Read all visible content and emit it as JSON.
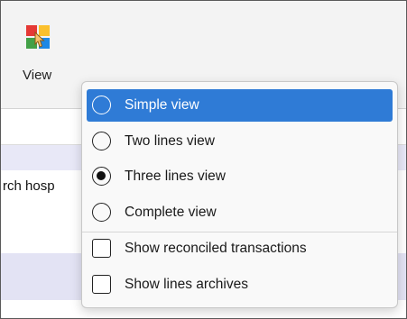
{
  "ribbon": {
    "view_button": {
      "label": "View",
      "icon": "view-options-icon"
    }
  },
  "grid": {
    "row_text": "rch hosp"
  },
  "view_menu": {
    "radio_options": [
      {
        "label": "Simple view",
        "checked": false,
        "highlighted": true
      },
      {
        "label": "Two lines view",
        "checked": false,
        "highlighted": false
      },
      {
        "label": "Three lines view",
        "checked": true,
        "highlighted": false
      },
      {
        "label": "Complete view",
        "checked": false,
        "highlighted": false
      }
    ],
    "checkbox_options": [
      {
        "label": "Show reconciled transactions",
        "checked": false
      },
      {
        "label": "Show lines archives",
        "checked": false
      }
    ]
  },
  "colors": {
    "highlight": "#2f7bd6",
    "ribbon_bg": "#f3f3f3",
    "band_lavender": "#e8e8f7"
  }
}
